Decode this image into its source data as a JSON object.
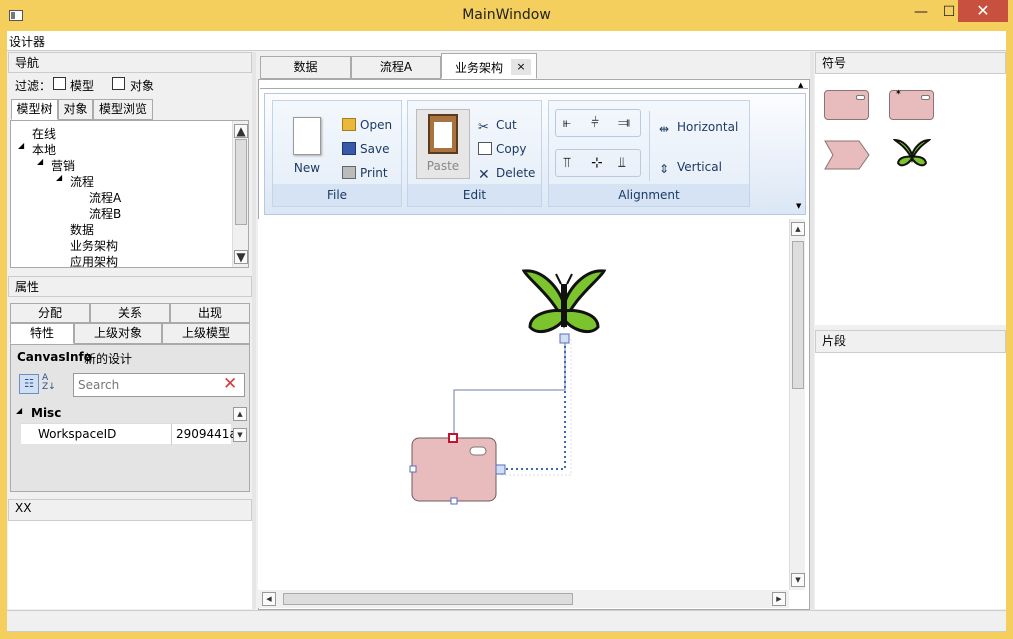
{
  "window": {
    "title": "MainWindow",
    "minimize": "—",
    "maximize": "☐",
    "close": "✕"
  },
  "menubar": {
    "label": "设计器"
  },
  "navigation": {
    "header": "导航",
    "filter_label": "过滤：",
    "filter_model": "模型",
    "filter_object": "对象",
    "tabs": [
      "模型树",
      "对象",
      "模型浏览"
    ],
    "tree": [
      "在线",
      "本地",
      "营销",
      "流程",
      "流程A",
      "流程B",
      "数据",
      "业务架构",
      "应用架构"
    ]
  },
  "properties": {
    "header": "属性",
    "tabs_row1": [
      "分配",
      "关系",
      "出现"
    ],
    "tabs_row2": [
      "特性",
      "上级对象",
      "上级模型"
    ],
    "canvas_info_label": "CanvasInfo",
    "canvas_info_value": "新的设计",
    "search_placeholder": "Search",
    "category": "Misc",
    "row_name": "WorkspaceID",
    "row_value": "2909441a"
  },
  "bottom_left": {
    "header": "XX"
  },
  "doc_tabs": [
    {
      "label": "数据",
      "active": false
    },
    {
      "label": "流程A",
      "active": false
    },
    {
      "label": "业务架构",
      "active": true,
      "close": "×"
    }
  ],
  "ribbon": {
    "file": {
      "label": "File",
      "new": "New",
      "open": "Open",
      "save": "Save",
      "print": "Print"
    },
    "edit": {
      "label": "Edit",
      "paste": "Paste",
      "cut": "Cut",
      "copy": "Copy",
      "delete": "Delete"
    },
    "alignment": {
      "label": "Alignment",
      "horizontal": "Horizontal",
      "vertical": "Vertical"
    }
  },
  "symbols": {
    "header": "符号"
  },
  "snippets": {
    "header": "片段"
  },
  "colors": {
    "titlebar": "#f5cf5e",
    "close_button": "#c7503e",
    "shape_fill": "#e8bcbc",
    "butterfly": "#7cc42e",
    "ribbon_text": "#1d3a63"
  }
}
